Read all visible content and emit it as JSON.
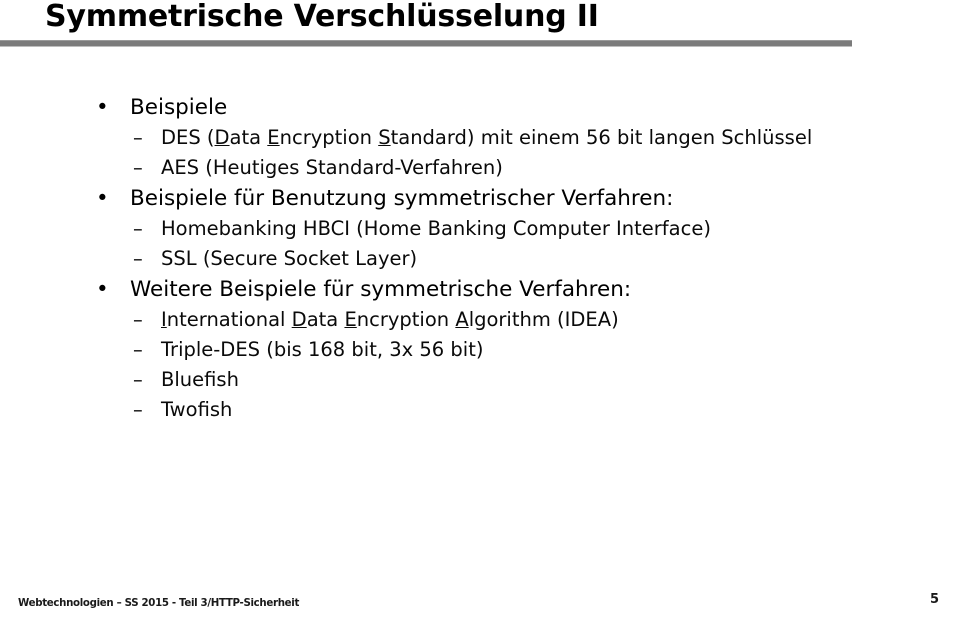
{
  "slide": {
    "title": "Symmetrische Verschlüsselung II",
    "divider_color": "#7b7b7b",
    "bullet_glyph": "•",
    "dash_glyph": "–",
    "body": [
      {
        "level": 1,
        "name": "bullet-beispiele",
        "text": "Beispiele",
        "segments": [
          {
            "t": "Beispiele",
            "u": false
          }
        ]
      },
      {
        "level": 2,
        "name": "bullet-des",
        "text": "DES (Data Encryption Standard) mit einem 56 bit langen Schlüssel",
        "segments": [
          {
            "t": "DES (",
            "u": false
          },
          {
            "t": "D",
            "u": true
          },
          {
            "t": "ata ",
            "u": false
          },
          {
            "t": "E",
            "u": true
          },
          {
            "t": "ncryption ",
            "u": false
          },
          {
            "t": "S",
            "u": true
          },
          {
            "t": "tandard) mit einem 56 bit langen Schlüssel",
            "u": false
          }
        ]
      },
      {
        "level": 2,
        "name": "bullet-aes",
        "text": "AES (Heutiges Standard-Verfahren)",
        "segments": [
          {
            "t": "AES (Heutiges Standard-Verfahren)",
            "u": false
          }
        ]
      },
      {
        "level": 1,
        "name": "bullet-beispiele-benutzung",
        "text": "Beispiele für Benutzung symmetrischer Verfahren:",
        "segments": [
          {
            "t": "Beispiele für Benutzung symmetrischer Verfahren:",
            "u": false
          }
        ]
      },
      {
        "level": 2,
        "name": "bullet-hbci",
        "text": "Homebanking HBCI (Home Banking Computer Interface)",
        "segments": [
          {
            "t": "Homebanking HBCI (Home Banking Computer Interface)",
            "u": false
          }
        ]
      },
      {
        "level": 2,
        "name": "bullet-ssl",
        "text": "SSL (Secure Socket Layer)",
        "segments": [
          {
            "t": "SSL (Secure Socket Layer)",
            "u": false
          }
        ]
      },
      {
        "level": 1,
        "name": "bullet-weitere-beispiele",
        "text": "Weitere Beispiele für symmetrische Verfahren:",
        "segments": [
          {
            "t": "Weitere Beispiele für symmetrische Verfahren:",
            "u": false
          }
        ]
      },
      {
        "level": 2,
        "name": "bullet-idea",
        "text": "International Data Encryption Algorithm (IDEA)",
        "segments": [
          {
            "t": "I",
            "u": true
          },
          {
            "t": "nternational ",
            "u": false
          },
          {
            "t": "D",
            "u": true
          },
          {
            "t": "ata ",
            "u": false
          },
          {
            "t": "E",
            "u": true
          },
          {
            "t": "ncryption ",
            "u": false
          },
          {
            "t": "A",
            "u": true
          },
          {
            "t": "lgorithm (IDEA)",
            "u": false
          }
        ]
      },
      {
        "level": 2,
        "name": "bullet-triple-des",
        "text": "Triple-DES (bis 168 bit, 3x 56 bit)",
        "segments": [
          {
            "t": "Triple-DES (bis 168 bit, 3x 56 bit)",
            "u": false
          }
        ]
      },
      {
        "level": 2,
        "name": "bullet-bluefish",
        "text": "Bluefish",
        "segments": [
          {
            "t": "Bluefish",
            "u": false
          }
        ]
      },
      {
        "level": 2,
        "name": "bullet-twofish",
        "text": "Twofish",
        "segments": [
          {
            "t": "Twofish",
            "u": false
          }
        ]
      }
    ]
  },
  "footer": {
    "left_text": "Webtechnologien – SS 2015 - Teil 3/HTTP-Sicherheit",
    "page_number": "5"
  }
}
